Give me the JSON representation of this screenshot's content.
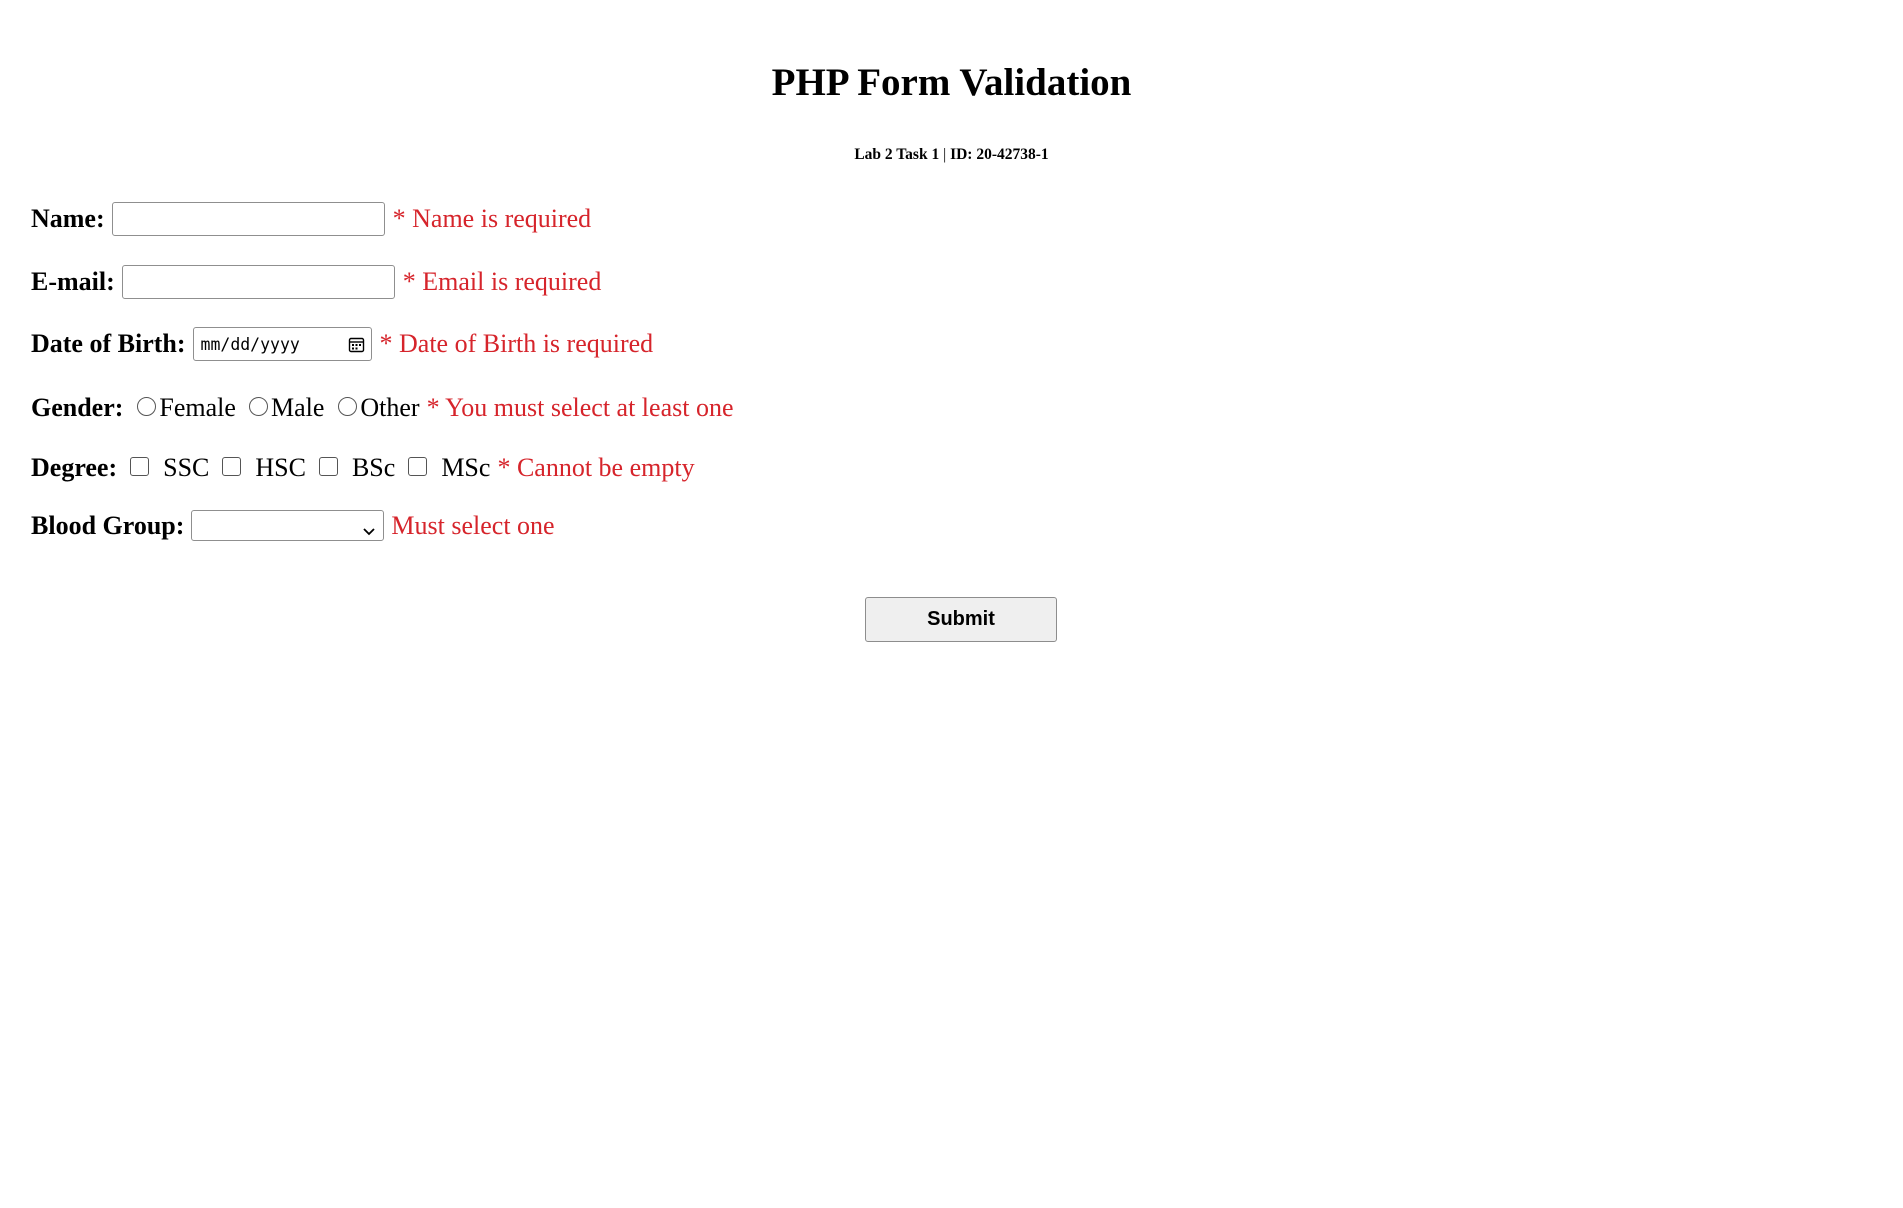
{
  "page": {
    "title": "PHP Form Validation",
    "subtitle_left": "Lab 2 Task 1",
    "subtitle_sep": "|",
    "subtitle_right": "ID: 20-42738-1"
  },
  "form": {
    "name": {
      "label": "Name:",
      "value": "",
      "error": "* Name is required"
    },
    "email": {
      "label": "E-mail:",
      "value": "",
      "error": "* Email is required"
    },
    "dob": {
      "label": "Date of Birth:",
      "placeholder": "mm/dd/yyyy",
      "error": "* Date of Birth is required",
      "icon": "calendar-icon"
    },
    "gender": {
      "label": "Gender:",
      "options": [
        "Female",
        "Male",
        "Other"
      ],
      "error": "* You must select at least one"
    },
    "degree": {
      "label": "Degree:",
      "options": [
        "SSC",
        "HSC",
        "BSc",
        "MSc"
      ],
      "error": "* Cannot be empty"
    },
    "blood_group": {
      "label": "Blood Group:",
      "selected": "",
      "error": "Must select one",
      "icon": "chevron-down-icon"
    },
    "submit_label": "Submit"
  },
  "colors": {
    "error": "#d6242b",
    "button_bg": "#efefef"
  }
}
